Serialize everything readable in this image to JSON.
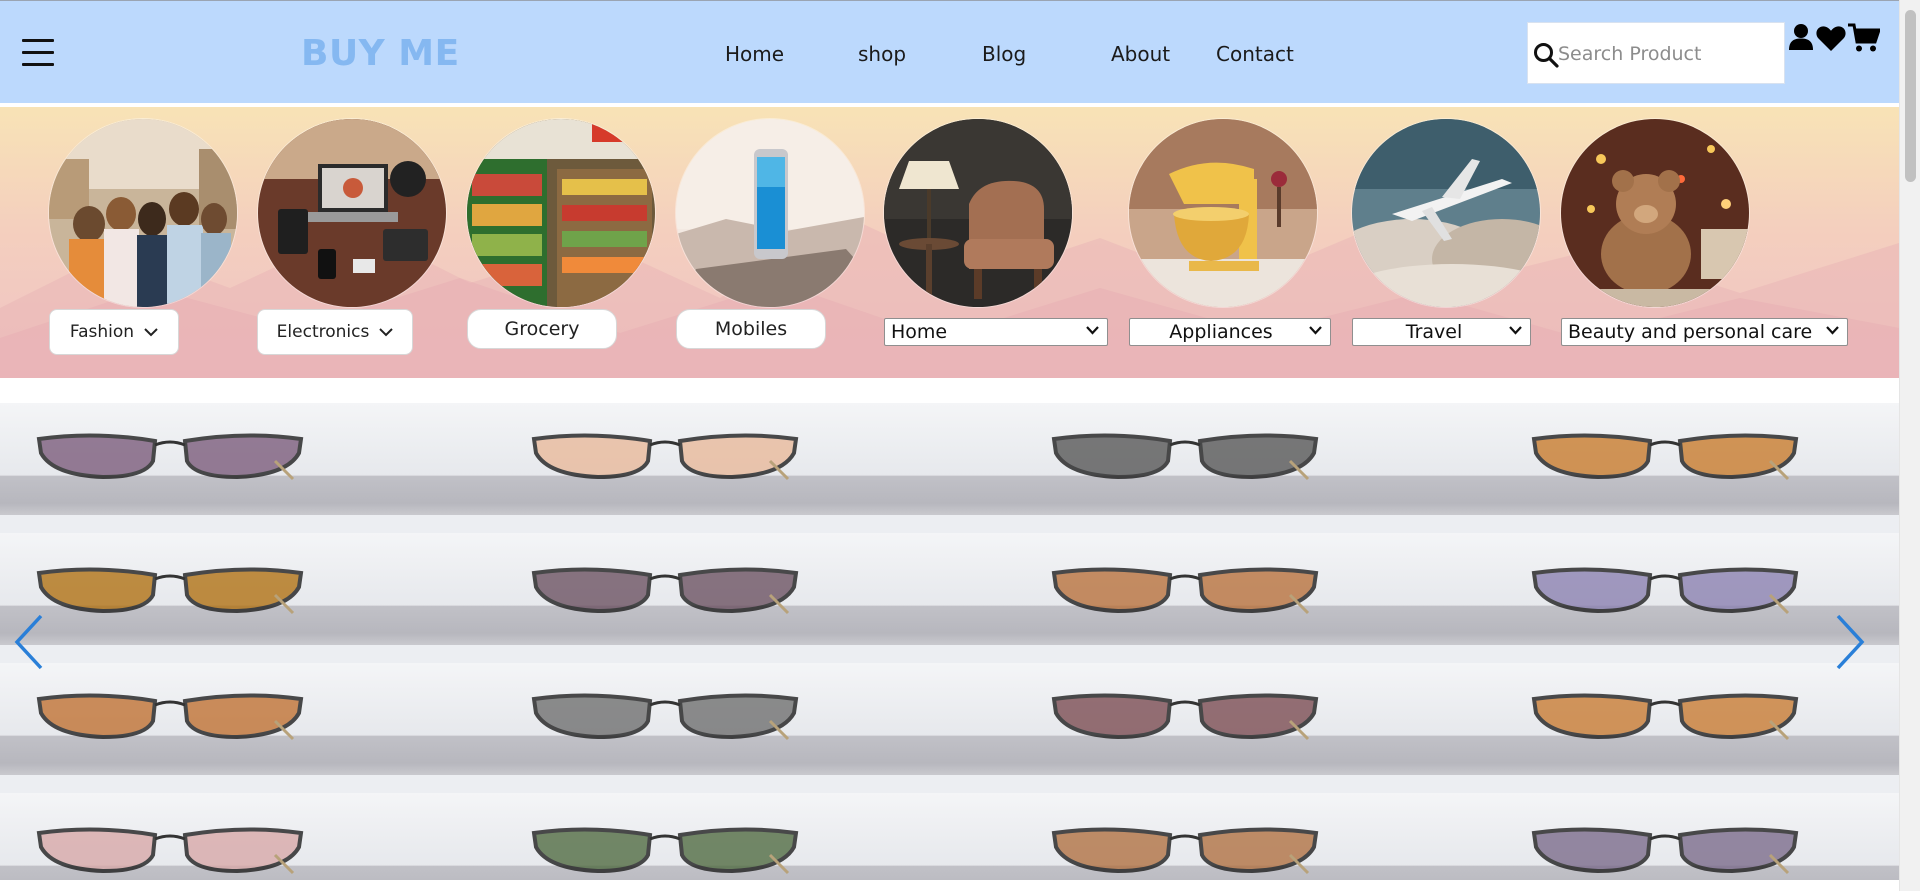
{
  "header": {
    "logo": "BUY ME",
    "nav": [
      "Home",
      "shop",
      "Blog",
      "About",
      "Contact"
    ],
    "search_placeholder": "Search Product",
    "icons": [
      "menu-icon",
      "search-icon",
      "user-icon",
      "heart-icon",
      "cart-icon"
    ],
    "bg_color": "#bcd9fd",
    "logo_color": "#85b8f1"
  },
  "categories": [
    {
      "label": "Fashion",
      "control": "dropdown-button",
      "image": "group-of-friends"
    },
    {
      "label": "Electronics",
      "control": "dropdown-button",
      "image": "desk-with-devices"
    },
    {
      "label": "Grocery",
      "control": "button",
      "image": "grocery-aisle"
    },
    {
      "label": "Mobiles",
      "control": "button",
      "image": "smartphone"
    },
    {
      "label": "Home",
      "control": "select",
      "image": "armchair-lamp"
    },
    {
      "label": "Appliances",
      "control": "select",
      "image": "stand-mixer"
    },
    {
      "label": "Travel",
      "control": "select",
      "image": "airplane-clouds"
    },
    {
      "label": "Beauty and personal care",
      "control": "select",
      "image": "teddy-bear"
    }
  ],
  "carousel": {
    "image": "sunglasses-on-shelves",
    "prev_icon": "chevron-left-icon",
    "next_icon": "chevron-right-icon",
    "arrow_color": "#2a7fd8"
  }
}
